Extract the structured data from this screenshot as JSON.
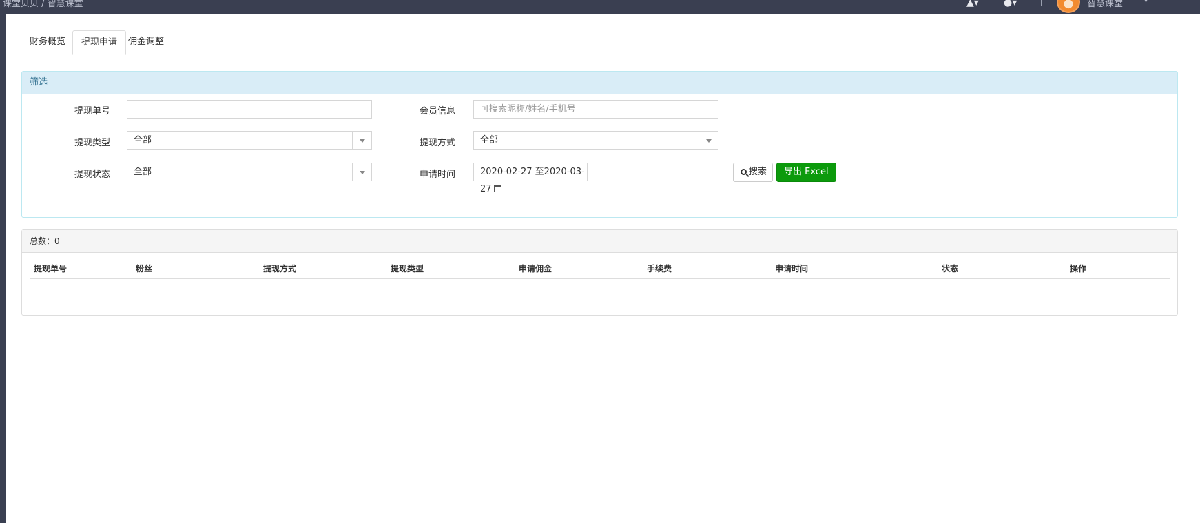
{
  "header": {
    "breadcrumb": "课堂贝贝 / 智慧课堂",
    "user_name": "智慧课堂",
    "icons": [
      "bell-icon",
      "user-icon",
      "chevron-down-icon"
    ]
  },
  "tabs": [
    {
      "label": "财务概览",
      "active": false
    },
    {
      "label": "提现申请",
      "active": true
    },
    {
      "label": "佣金调整",
      "active": false
    }
  ],
  "filter": {
    "title": "筛选",
    "order_no": {
      "label": "提现单号",
      "value": "",
      "placeholder": ""
    },
    "member_info": {
      "label": "会员信息",
      "value": "",
      "placeholder": "可搜索昵称/姓名/手机号"
    },
    "withdraw_type": {
      "label": "提现类型",
      "value": "全部"
    },
    "withdraw_method": {
      "label": "提现方式",
      "value": "全部"
    },
    "withdraw_status": {
      "label": "提现状态",
      "value": "全部"
    },
    "apply_time": {
      "label": "申请时间",
      "value": "2020-02-27 至2020-03-27"
    },
    "search_button": "搜索",
    "export_button": "导出 Excel"
  },
  "list": {
    "total_label": "总数：0",
    "columns": [
      "提现单号",
      "粉丝",
      "提现方式",
      "提现类型",
      "申请佣金",
      "手续费",
      "申请时间",
      "状态",
      "操作"
    ],
    "rows": []
  },
  "colors": {
    "header_bg": "#3a3f51",
    "filter_head_bg": "#d9edf7",
    "filter_head_text": "#31708f",
    "export_button_bg": "#0c9a0c"
  }
}
